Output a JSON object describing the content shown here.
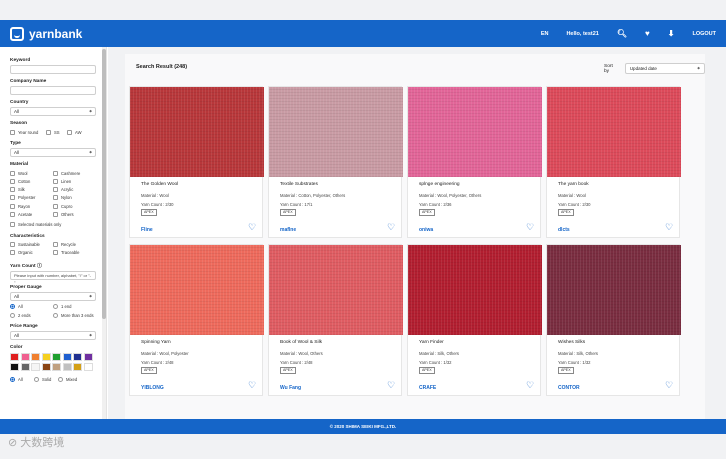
{
  "header": {
    "brand": "yarnbank",
    "lang": "EN",
    "greeting": "Hello, test21",
    "logout": "LOGOUT",
    "icons": [
      "search-icon",
      "heart-icon",
      "download-icon"
    ]
  },
  "sidebar": {
    "keyword_label": "Keyword",
    "company_label": "Company Name",
    "country_label": "Country",
    "country_value": "All",
    "season_label": "Season",
    "seasons": [
      "Year round",
      "SS",
      "AW"
    ],
    "type_label": "Type",
    "type_value": "All",
    "material_label": "Material",
    "materials": [
      "Wool",
      "Cashmere",
      "Cotton",
      "Linen",
      "Silk",
      "Acrylic",
      "Polyester",
      "Nylon",
      "Rayon",
      "Cupro",
      "Acetate",
      "Others"
    ],
    "selected_only": "Selected materials only",
    "characteristics_label": "Characteristics",
    "characteristics": [
      "Sustainable",
      "Recycle",
      "Organic",
      "Traceable"
    ],
    "yarn_count_label": "Yarn Count",
    "yarn_count_placeholder": "Please input with number, alphabet, \"/\" or \"-\"",
    "proper_gauge_label": "Proper Gauge",
    "proper_gauge_value": "All",
    "ends": [
      "All",
      "1 end",
      "2 ends",
      "More than 3 ends"
    ],
    "price_label": "Price Range",
    "price_value": "All",
    "color_label": "Color",
    "colors": [
      "#e02020",
      "#f06090",
      "#f08030",
      "#f5d020",
      "#20a030",
      "#2060d0",
      "#203090",
      "#7030a0",
      "#111111",
      "#666666",
      "#f5f5f5",
      "#8b4513",
      "#c0a080",
      "#c0c0c0",
      "#d4a017",
      "#ffffff"
    ],
    "pattern_options": [
      "All",
      "Solid",
      "Mixed"
    ]
  },
  "main": {
    "result_label": "Search Result (248)",
    "sort_label": "Sort by",
    "sort_value": "Updated date",
    "cards": [
      {
        "name": "The Golden Wool",
        "material": "Material : Wool",
        "yarn": "Yarn Count : 2/30",
        "badge": "APEX",
        "maker": "Fline",
        "color": "#b8373a"
      },
      {
        "name": "Textile Substrates",
        "material": "Material : Cotton, Polyester, Others",
        "yarn": "Yarn Count : 17/1",
        "badge": "APEX",
        "maker": "maflne",
        "color": "#c99ba4"
      },
      {
        "name": "splnge engineering",
        "material": "Material : Wool, Polyester, Others",
        "yarn": "Yarn Count : 2/36",
        "badge": "APEX",
        "maker": "oniwa",
        "color": "#e26598"
      },
      {
        "name": "The yarn book",
        "material": "Material : Wool",
        "yarn": "Yarn Count : 2/30",
        "badge": "APEX",
        "maker": "dlcts",
        "color": "#dc4a5a"
      },
      {
        "name": "Spinning Yarn",
        "material": "Material : Wool, Polyester",
        "yarn": "Yarn Count : 2/48",
        "badge": "APEX",
        "maker": "YIBLONG",
        "color": "#ee6a5c"
      },
      {
        "name": "Book of Wool & Silk",
        "material": "Material : Wool, Others",
        "yarn": "Yarn Count : 2/48",
        "badge": "APEX",
        "maker": "Wu Fang",
        "color": "#df5c62"
      },
      {
        "name": "Yarn Finder",
        "material": "Material : Silk, Others",
        "yarn": "Yarn Count : 1/32",
        "badge": "APEX",
        "maker": "CRAFE",
        "color": "#b21e30"
      },
      {
        "name": "Wishes Silks",
        "material": "Material : Silk, Others",
        "yarn": "Yarn Count : 1/32",
        "badge": "APEX",
        "maker": "CONTOR",
        "color": "#7a2d40"
      }
    ],
    "partial_colors": [
      "#2a3550",
      "#1f2a45",
      "#1f2a45",
      "#d8cfc4"
    ]
  },
  "footer": {
    "copyright": "© 2020 SHIMA SEIKI MFG.,LTD."
  },
  "watermark": "大数跨境"
}
